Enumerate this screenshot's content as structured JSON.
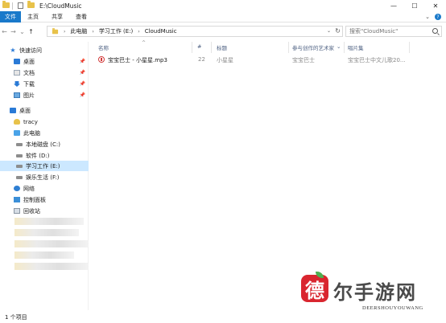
{
  "window": {
    "title": "E:\\CloudMusic",
    "controls": {
      "minimize": "—",
      "maximize": "☐",
      "close": "✕"
    }
  },
  "ribbon": {
    "tabs": [
      "文件",
      "主页",
      "共享",
      "查看"
    ],
    "expand_glyph": "⌄",
    "help_glyph": "?"
  },
  "addressbar": {
    "back_glyph": "←",
    "forward_glyph": "→",
    "recent_glyph": "⌄",
    "up_glyph": "↑",
    "breadcrumbs": [
      "此电脑",
      "学习工作 (E:)",
      "CloudMusic"
    ],
    "crumb_sep": "›",
    "dropdown_glyph": "⌄",
    "refresh_glyph": "↻",
    "search_placeholder": "搜索\"CloudMusic\""
  },
  "navpane": {
    "quick_access": {
      "label": "快速访问",
      "icon": "star-icon"
    },
    "quick_items": [
      {
        "label": "桌面",
        "icon": "desktop-icon",
        "pinned": true
      },
      {
        "label": "文档",
        "icon": "documents-icon",
        "pinned": true
      },
      {
        "label": "下载",
        "icon": "downloads-icon",
        "pinned": true
      },
      {
        "label": "图片",
        "icon": "pictures-icon",
        "pinned": true
      }
    ],
    "pin_glyph": "📌",
    "tree": [
      {
        "label": "桌面",
        "icon": "desktop-icon"
      },
      {
        "label": "tracy",
        "icon": "user-folder-icon"
      },
      {
        "label": "此电脑",
        "icon": "this-pc-icon"
      },
      {
        "label": "本地磁盘 (C:)",
        "icon": "drive-icon"
      },
      {
        "label": "软件 (D:)",
        "icon": "drive-icon"
      },
      {
        "label": "学习工作 (E:)",
        "icon": "drive-icon",
        "selected": true
      },
      {
        "label": "娱乐生活 (F:)",
        "icon": "drive-icon"
      },
      {
        "label": "网络",
        "icon": "network-icon"
      },
      {
        "label": "控制面板",
        "icon": "control-panel-icon"
      },
      {
        "label": "回收站",
        "icon": "recycle-bin-icon"
      }
    ]
  },
  "columns": {
    "headers": [
      "名称",
      "#",
      "标题",
      "参与创作的艺术家",
      "唱片集"
    ],
    "sort_glyph": "^",
    "filter_glyph": "⌄"
  },
  "files": [
    {
      "name": "宝宝巴士 - 小星星.mp3",
      "track": "22",
      "title": "小星星",
      "artist": "宝宝巴士",
      "album": "宝宝巴士中文儿歌20..."
    }
  ],
  "statusbar": {
    "count": "1 个项目"
  },
  "watermark": {
    "badge": "德",
    "text": "尔手游网",
    "sub": "DEERSHOUYOUWANG"
  },
  "colors": {
    "accent": "#1979ca",
    "selection": "#cce8ff",
    "header_text": "#4d6082",
    "watermark_red": "#d9262f"
  }
}
